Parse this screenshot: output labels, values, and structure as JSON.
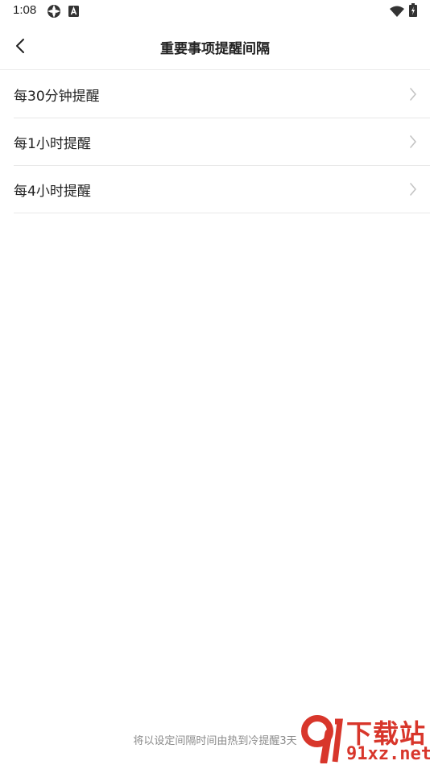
{
  "status_bar": {
    "time": "1:08",
    "icons": [
      "settings-gear-icon",
      "a-box-icon",
      "wifi-icon",
      "battery-charging-icon"
    ]
  },
  "header": {
    "title": "重要事项提醒间隔",
    "back_icon": "chevron-left-icon"
  },
  "options": [
    {
      "label": "每30分钟提醒",
      "icon": "chevron-right-icon"
    },
    {
      "label": "每1小时提醒",
      "icon": "chevron-right-icon"
    },
    {
      "label": "每4小时提醒",
      "icon": "chevron-right-icon"
    }
  ],
  "footer": {
    "note": "将以设定间隔时间由热到冷提醒3天"
  },
  "watermark": {
    "brand_top": "下载站",
    "brand_bottom": "91xz.net",
    "color": "#d8362b"
  }
}
